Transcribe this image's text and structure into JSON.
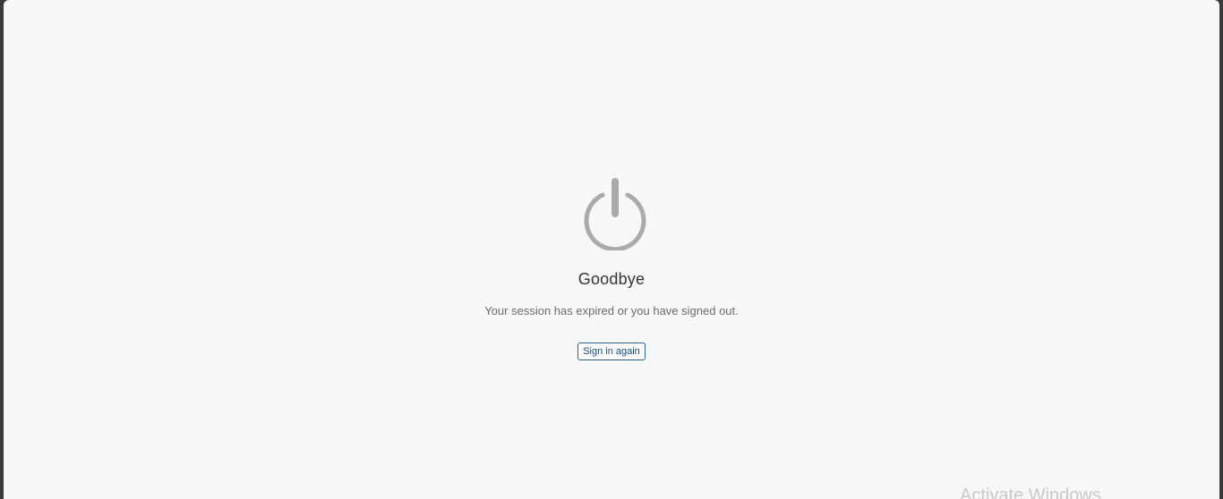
{
  "logout_page": {
    "icon": "power-icon",
    "title": "Goodbye",
    "message": "Your session has expired or you have signed out.",
    "signin_label": "Sign in again"
  },
  "watermark": {
    "text": "Activate Windows"
  },
  "colors": {
    "background": "#f7f7f7",
    "icon": "#aaaaaa",
    "button_border": "#2a5f8f",
    "button_text": "#0a4a7e"
  }
}
